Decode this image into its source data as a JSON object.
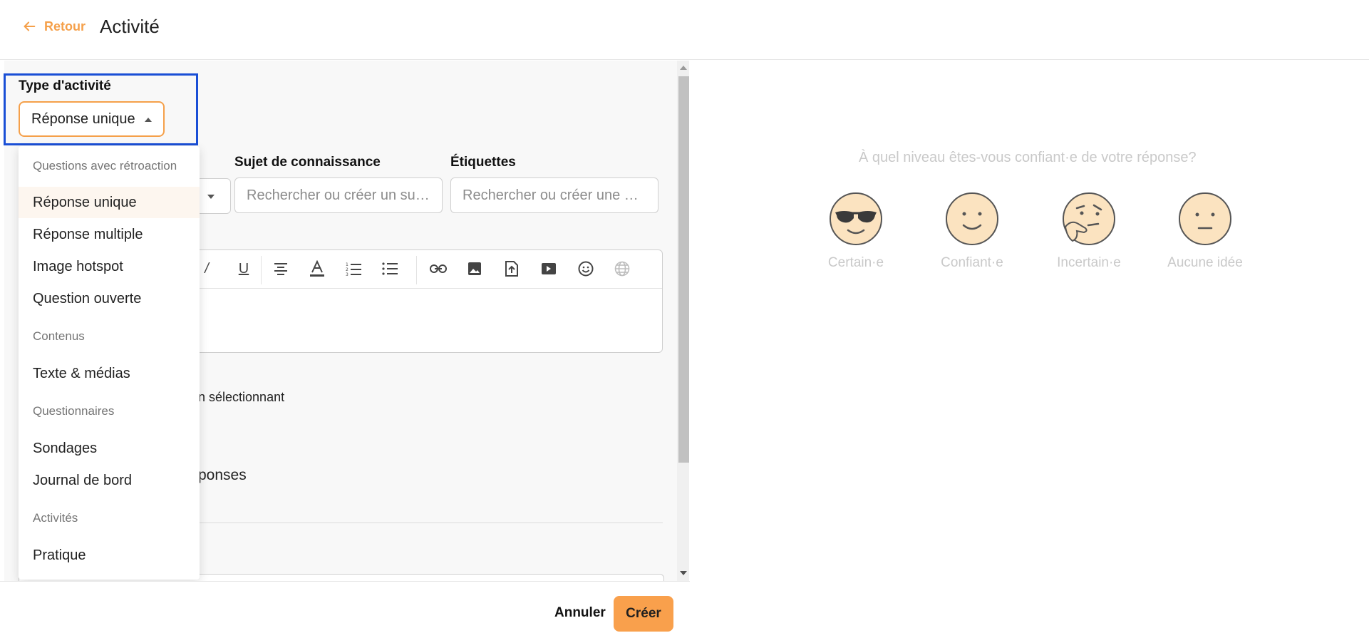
{
  "header": {
    "back_label": "Retour",
    "title": "Activité"
  },
  "form": {
    "type_label": "Type d'activité",
    "type_value": "Réponse unique",
    "subject_label": "Sujet de connaissance",
    "subject_placeholder": "Rechercher ou créer un su…",
    "tags_label": "Étiquettes",
    "tags_placeholder": "Rechercher ou créer une …",
    "partial_text_1": "n sélectionnant",
    "partial_text_2": "ponses"
  },
  "dropdown": {
    "groups": [
      {
        "label": "Questions avec rétroaction",
        "items": [
          "Réponse unique",
          "Réponse multiple",
          "Image hotspot",
          "Question ouverte"
        ]
      },
      {
        "label": "Contenus",
        "items": [
          "Texte & médias"
        ]
      },
      {
        "label": "Questionnaires",
        "items": [
          "Sondages",
          "Journal de bord"
        ]
      },
      {
        "label": "Activités",
        "items": [
          "Pratique"
        ]
      }
    ],
    "selected": "Réponse unique"
  },
  "footer": {
    "cancel_label": "Annuler",
    "create_label": "Créer"
  },
  "preview": {
    "question": "À quel niveau êtes-vous confiant·e de votre réponse?",
    "options": [
      {
        "label": "Certain·e",
        "icon": "sunglasses-emoji-icon"
      },
      {
        "label": "Confiant·e",
        "icon": "smiling-emoji-icon"
      },
      {
        "label": "Incertain·e",
        "icon": "thinking-emoji-icon"
      },
      {
        "label": "Aucune idée",
        "icon": "neutral-emoji-icon"
      }
    ]
  },
  "colors": {
    "accent": "#f5a04a",
    "button": "#f9a04c",
    "highlight": "#1a4fd6",
    "emoji_fill": "#fbe3c0"
  }
}
